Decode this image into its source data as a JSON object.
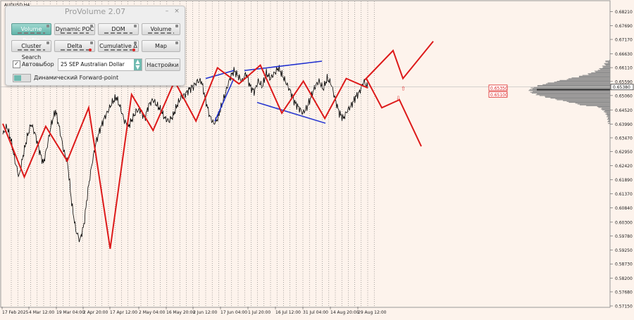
{
  "symbol": "AUDUSD,H4",
  "chart_data": {
    "type": "line",
    "title": "",
    "xlabel": "",
    "ylabel": "",
    "ylim": [
      0.5715,
      0.6844
    ],
    "y_ticks": [
      "0.68210",
      "0.67690",
      "0.67170",
      "0.66630",
      "0.66110",
      "0.65590",
      "0.65060",
      "0.64520",
      "0.63990",
      "0.63470",
      "0.62950",
      "0.62420",
      "0.61890",
      "0.61370",
      "0.60840",
      "0.60300",
      "0.59780",
      "0.59250",
      "0.58730",
      "0.58200",
      "0.57680",
      "0.57150"
    ],
    "x_ticks": [
      "17 Feb 2025",
      "4 Mar 12:00",
      "19 Mar 04:00",
      "2 Apr 20:00",
      "17 Apr 12:00",
      "2 May 04:00",
      "16 May 20:00",
      "2 Jun 12:00",
      "17 Jun 04:00",
      "1 Jul 20:00",
      "16 Jul 12:00",
      "31 Jul 04:00",
      "14 Aug 20:00",
      "29 Aug 12:00"
    ],
    "current_price": "0.65380",
    "levels": [
      "0.65350",
      "0.65100"
    ],
    "series": [
      {
        "values": [
          0.636,
          0.639,
          0.634,
          0.626,
          0.62,
          0.628,
          0.635,
          0.64,
          0.636,
          0.63,
          0.625,
          0.632,
          0.64,
          0.645,
          0.638,
          0.63,
          0.625,
          0.61,
          0.6,
          0.596,
          0.602,
          0.615,
          0.625,
          0.633,
          0.638,
          0.642,
          0.645,
          0.648,
          0.65,
          0.646,
          0.641,
          0.639,
          0.642,
          0.645,
          0.645,
          0.642,
          0.647,
          0.649,
          0.647,
          0.645,
          0.642,
          0.641,
          0.643,
          0.647,
          0.65,
          0.651,
          0.653,
          0.654,
          0.656,
          0.656,
          0.649,
          0.643,
          0.64,
          0.642,
          0.647,
          0.652,
          0.657,
          0.66,
          0.658,
          0.656,
          0.659,
          0.654,
          0.652,
          0.656,
          0.654,
          0.659,
          0.657,
          0.659,
          0.661,
          0.658,
          0.655,
          0.652,
          0.648,
          0.646,
          0.644,
          0.646,
          0.65,
          0.654,
          0.656,
          0.653,
          0.657,
          0.655,
          0.649,
          0.644,
          0.642,
          0.645,
          0.647,
          0.65,
          0.652,
          0.656,
          0.6535
        ]
      },
      {
        "values": [
          0.64,
          0.62,
          0.639,
          0.626,
          0.646,
          0.593,
          0.651,
          0.6375,
          0.656,
          0.641,
          0.661,
          0.655,
          0.662,
          0.644,
          0.656,
          0.642,
          0.657,
          0.6535
        ]
      },
      {
        "values": [
          0.6565,
          0.6585,
          0.64,
          0.65,
          0.641,
          0.662,
          0.667,
          0.64,
          0.6465,
          0.6315
        ]
      },
      {
        "values": [
          0.657,
          0.66,
          0.641,
          0.66,
          0.6635,
          0.648,
          0.6402
        ]
      },
      {
        "values": [
          0.6533,
          0.6572,
          0.6435
        ]
      }
    ]
  },
  "panel": {
    "title": "ProVolume 2.07",
    "buttons": [
      "Volume Profile",
      "Dynamic POC",
      "DOM",
      "Volume",
      "Cluster Search",
      "Delta",
      "Cumulative Δ",
      "Map"
    ],
    "autoselect_label": "Автовыбор",
    "autoselect_checked": "✓",
    "instrument_value": "25 SEP Australian Dollar",
    "settings_label": "Настройки",
    "forward_point_label": "Динамический Forward-point"
  }
}
